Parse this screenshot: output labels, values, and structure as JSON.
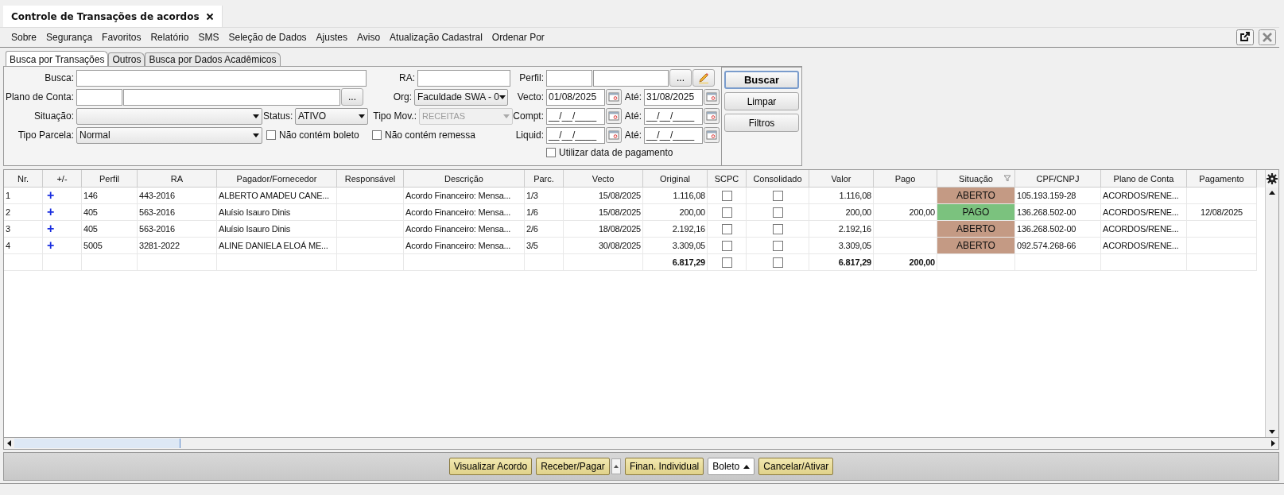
{
  "tab": {
    "title": "Controle de Transações de acordos"
  },
  "menu": [
    "Sobre",
    "Segurança",
    "Favoritos",
    "Relatório",
    "SMS",
    "Seleção de Dados",
    "Ajustes",
    "Aviso",
    "Atualização Cadastral",
    "Ordenar Por"
  ],
  "search_tabs": [
    {
      "label": "Busca por Transações",
      "selected": true
    },
    {
      "label": "Outros",
      "selected": false
    },
    {
      "label": "Busca por Dados Acadêmicos",
      "selected": false
    }
  ],
  "form": {
    "busca": {
      "label": "Busca:"
    },
    "ra": {
      "label": "RA:"
    },
    "perfil": {
      "label": "Perfil:",
      "button": "..."
    },
    "plano_de_conta": {
      "label": "Plano de Conta:",
      "button": "..."
    },
    "org": {
      "label": "Org:",
      "value": "Faculdade SWA - 0"
    },
    "vecto": {
      "label": "Vecto:",
      "from": "01/08/2025",
      "to_label": "Até:",
      "to": "31/08/2025"
    },
    "situacao": {
      "label": "Situação:"
    },
    "status": {
      "label": "Status:",
      "value": "ATIVO"
    },
    "tipo_mov": {
      "label": "Tipo Mov.:",
      "value": "RECEITAS",
      "disabled": true
    },
    "compt": {
      "label": "Compt:",
      "from": "__/__/____",
      "to_label": "Até:",
      "to": "__/__/____"
    },
    "tipo_parcela": {
      "label": "Tipo Parcela:",
      "value": "Normal"
    },
    "nao_contem_boleto": {
      "label": "Não contém boleto",
      "checked": false
    },
    "nao_contem_remessa": {
      "label": "Não contém remessa",
      "checked": false
    },
    "liquid": {
      "label": "Liquid:",
      "from": "__/__/____",
      "to_label": "Até:",
      "to": "__/__/____"
    },
    "utilizar_data_pagamento": {
      "label": "Utilizar data de pagamento",
      "checked": false
    }
  },
  "actions": [
    "Buscar",
    "Limpar",
    "Filtros"
  ],
  "table": {
    "columns": [
      {
        "label": "Nr.",
        "filtered": false
      },
      {
        "label": "+/-",
        "filtered": false
      },
      {
        "label": "Perfil",
        "filtered": false
      },
      {
        "label": "RA",
        "filtered": false
      },
      {
        "label": "Pagador/Fornecedor",
        "filtered": false
      },
      {
        "label": "Responsável",
        "filtered": false
      },
      {
        "label": "Descrição",
        "filtered": false
      },
      {
        "label": "Parc.",
        "filtered": false
      },
      {
        "label": "Vecto",
        "filtered": false
      },
      {
        "label": "Original",
        "filtered": false
      },
      {
        "label": "SCPC",
        "filtered": false
      },
      {
        "label": "Consolidado",
        "filtered": false
      },
      {
        "label": "Valor",
        "filtered": false
      },
      {
        "label": "Pago",
        "filtered": false
      },
      {
        "label": "Situação",
        "filtered": true
      },
      {
        "label": "CPF/CNPJ",
        "filtered": false
      },
      {
        "label": "Plano de Conta",
        "filtered": false
      },
      {
        "label": "Pagamento",
        "filtered": false
      }
    ],
    "rows": [
      {
        "nr": "1",
        "toggle": "+",
        "perfil": "146",
        "ra": "443-2016",
        "pagador": "ALBERTO AMADEU CANE...",
        "descricao": "Acordo Financeiro: Mensa...",
        "parc": "1/3",
        "vecto": "15/08/2025",
        "original": "1.116,08",
        "scpc": false,
        "consolidado": false,
        "valor": "1.116,08",
        "situacao": {
          "label": "ABERTO",
          "color": "#c49a84"
        },
        "cpf": "105.193.159-28",
        "plano": "ACORDOS/RENE..."
      },
      {
        "nr": "2",
        "toggle": "+",
        "perfil": "405",
        "ra": "563-2016",
        "pagador": "Aluísio Isauro Dinis",
        "descricao": "Acordo Financeiro: Mensa...",
        "parc": "1/6",
        "vecto": "15/08/2025",
        "original": "200,00",
        "scpc": false,
        "consolidado": false,
        "valor": "200,00",
        "pago": "200,00",
        "situacao": {
          "label": "PAGO",
          "color": "#7bc27e"
        },
        "cpf": "136.268.502-00",
        "plano": "ACORDOS/RENE...",
        "pagamento": "12/08/2025"
      },
      {
        "nr": "3",
        "toggle": "+",
        "perfil": "405",
        "ra": "563-2016",
        "pagador": "Aluísio Isauro Dinis",
        "descricao": "Acordo Financeiro: Mensa...",
        "parc": "2/6",
        "vecto": "18/08/2025",
        "original": "2.192,16",
        "scpc": false,
        "consolidado": false,
        "valor": "2.192,16",
        "situacao": {
          "label": "ABERTO",
          "color": "#c49a84"
        },
        "cpf": "136.268.502-00",
        "plano": "ACORDOS/RENE..."
      },
      {
        "nr": "4",
        "toggle": "+",
        "perfil": "5005",
        "ra": "3281-2022",
        "pagador": "ALINE DANIELA ELOÁ ME...",
        "descricao": "Acordo Financeiro: Mensa...",
        "parc": "3/5",
        "vecto": "30/08/2025",
        "original": "3.309,05",
        "scpc": false,
        "consolidado": false,
        "valor": "3.309,05",
        "situacao": {
          "label": "ABERTO",
          "color": "#c49a84"
        },
        "cpf": "092.574.268-66",
        "plano": "ACORDOS/RENE..."
      }
    ],
    "totals": {
      "original": "6.817,29",
      "scpc": false,
      "consolidado": false,
      "valor": "6.817,29",
      "pago": "200,00"
    }
  },
  "bottom_buttons": [
    {
      "label": "Visualizar Acordo",
      "kind": "button"
    },
    {
      "label": "Receber/Pagar",
      "kind": "split"
    },
    {
      "label": "Finan. Individual",
      "kind": "button"
    },
    {
      "label": "Boleto",
      "kind": "menu"
    },
    {
      "label": "Cancelar/Ativar",
      "kind": "button"
    }
  ]
}
